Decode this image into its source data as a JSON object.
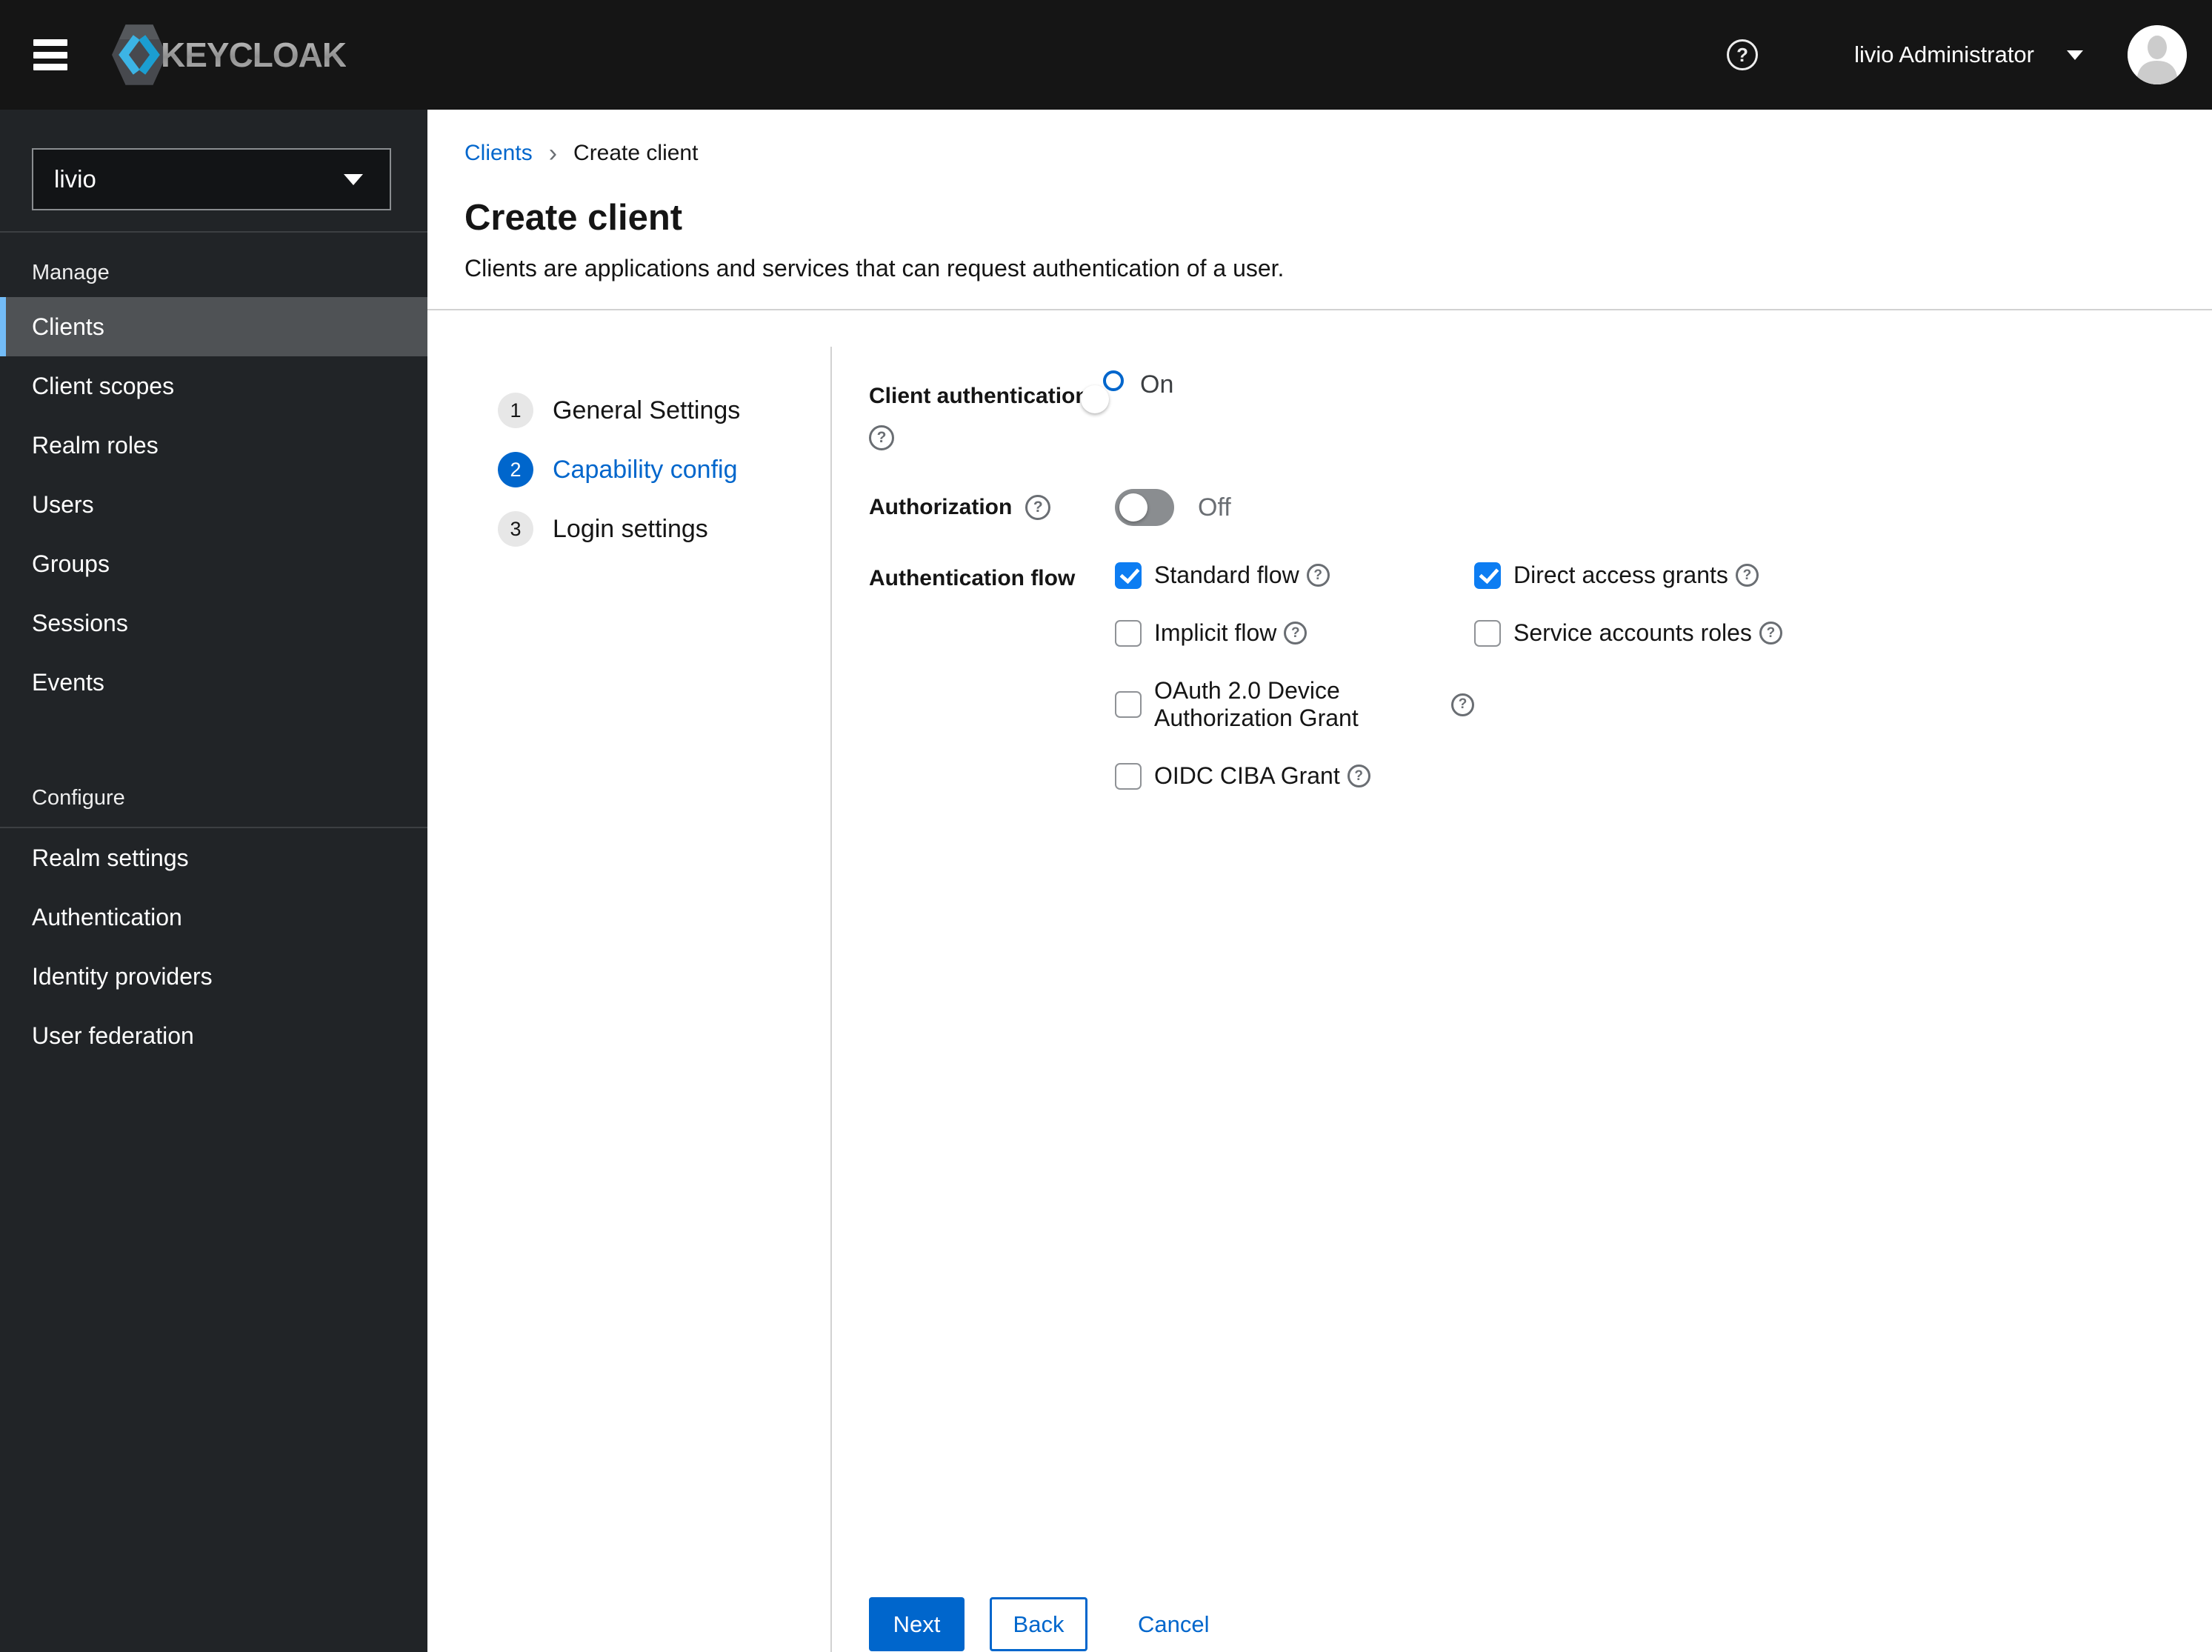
{
  "header": {
    "brand": "KEYCLOAK",
    "user_label": "livio Administrator",
    "help_glyph": "?"
  },
  "sidebar": {
    "realm_selector": {
      "value": "livio"
    },
    "sections": [
      {
        "title": "Manage",
        "items": [
          {
            "label": "Clients",
            "selected": true
          },
          {
            "label": "Client scopes",
            "selected": false
          },
          {
            "label": "Realm roles",
            "selected": false
          },
          {
            "label": "Users",
            "selected": false
          },
          {
            "label": "Groups",
            "selected": false
          },
          {
            "label": "Sessions",
            "selected": false
          },
          {
            "label": "Events",
            "selected": false
          }
        ]
      },
      {
        "title": "Configure",
        "items": [
          {
            "label": "Realm settings",
            "selected": false
          },
          {
            "label": "Authentication",
            "selected": false
          },
          {
            "label": "Identity providers",
            "selected": false
          },
          {
            "label": "User federation",
            "selected": false
          }
        ]
      }
    ]
  },
  "breadcrumb": {
    "link": "Clients",
    "separator": "›",
    "current": "Create client"
  },
  "page": {
    "title": "Create client",
    "subtitle": "Clients are applications and services that can request authentication of a user."
  },
  "wizard": {
    "steps": [
      {
        "number": "1",
        "label": "General Settings",
        "active": false
      },
      {
        "number": "2",
        "label": "Capability config",
        "active": true
      },
      {
        "number": "3",
        "label": "Login settings",
        "active": false
      }
    ]
  },
  "form": {
    "client_auth": {
      "label": "Client authentication",
      "state": "On",
      "enabled": true
    },
    "authorization": {
      "label": "Authorization",
      "state": "Off",
      "enabled": false
    },
    "auth_flow": {
      "label": "Authentication flow",
      "options": [
        {
          "label": "Standard flow",
          "checked": true
        },
        {
          "label": "Direct access grants",
          "checked": true
        },
        {
          "label": "Implicit flow",
          "checked": false
        },
        {
          "label": "Service accounts roles",
          "checked": false
        },
        {
          "label": "OAuth 2.0 Device Authorization Grant",
          "checked": false
        },
        {
          "label": "OIDC CIBA Grant",
          "checked": false
        }
      ]
    },
    "help_glyph": "?"
  },
  "actions": {
    "next": "Next",
    "back": "Back",
    "cancel": "Cancel"
  },
  "colors": {
    "accent": "#0066cc",
    "header-bg": "#151515",
    "sidebar-bg": "#212427",
    "sidebar-selected": "#4f5255",
    "sidebar-accent": "#73bcf7",
    "toggle-off": "#8a8d90",
    "checkbox-blue": "#0d7df2",
    "divider": "#d2d2d2"
  }
}
